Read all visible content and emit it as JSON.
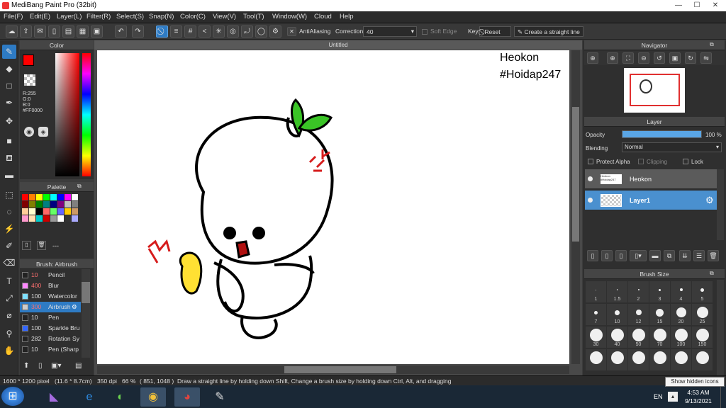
{
  "window": {
    "title": "MediBang Paint Pro (32bit)",
    "min": "—",
    "max": "☐",
    "close": "✕"
  },
  "menu": [
    "File(F)",
    "Edit(E)",
    "Layer(L)",
    "Filter(R)",
    "Select(S)",
    "Snap(N)",
    "Color(C)",
    "View(V)",
    "Tool(T)",
    "Window(W)",
    "Cloud",
    "Help"
  ],
  "toolbar": {
    "antialiasing": "AntiAliasing",
    "correction_label": "Correction",
    "correction_value": "40",
    "soft_edge": "Soft Edge",
    "key": "Key",
    "reset": "Reset",
    "straight_line": "Create a straight line"
  },
  "color_panel": {
    "title": "Color",
    "r": "R:255",
    "g": "G:0",
    "b": "B:0",
    "hex": "#FF0000",
    "accent": "#ff0000"
  },
  "palette_panel": {
    "title": "Palette",
    "footer": "---"
  },
  "brush_panel": {
    "title": "Brush: Airbrush",
    "brushes": [
      {
        "size": "10",
        "name": "Pencil",
        "color": "#222222"
      },
      {
        "size": "400",
        "name": "Blur",
        "color": "#ff88ff"
      },
      {
        "size": "100",
        "name": "Watercolor",
        "color": "#7fe0ff"
      },
      {
        "size": "300",
        "name": "Airbrush",
        "color": "#cccccc"
      },
      {
        "size": "10",
        "name": "Pen",
        "color": "#222222"
      },
      {
        "size": "100",
        "name": "Sparkle Bru",
        "color": "#3366ff"
      },
      {
        "size": "282",
        "name": "Rotation Sy",
        "color": "#222222"
      },
      {
        "size": "10",
        "name": "Pen (Sharp",
        "color": "#222222"
      }
    ]
  },
  "canvas": {
    "tab": "Untitled",
    "text_line1": "Heokon",
    "text_line2": "#Hoidap247"
  },
  "navigator": {
    "title": "Navigator"
  },
  "layer_panel": {
    "title": "Layer",
    "opacity_label": "Opacity",
    "opacity_value": "100 %",
    "opacity_fraction": 1.0,
    "blending_label": "Blending",
    "blending_value": "Normal",
    "protect_alpha": "Protect Alpha",
    "clipping": "Clipping",
    "lock": "Lock",
    "layers": [
      {
        "name": "Heokon",
        "thumb": "Heokon #Hoidap247",
        "selected": false
      },
      {
        "name": "Layer1",
        "selected": true
      }
    ]
  },
  "brush_size_panel": {
    "title": "Brush Size",
    "sizes": [
      "1",
      "1.5",
      "2",
      "3",
      "4",
      "5",
      "7",
      "10",
      "12",
      "15",
      "20",
      "25",
      "30",
      "40",
      "50",
      "70",
      "100",
      "150",
      "",
      "",
      "",
      "",
      "",
      ""
    ],
    "tooltip": "Show hidden icons"
  },
  "status": {
    "size": "1600 * 1200 pixel",
    "cm": "(11.6 * 8.7cm)",
    "dpi": "350 dpi",
    "zoom": "66 %",
    "coords": "( 851, 1048 )",
    "hint": "Draw a straight line by holding down Shift, Change a brush size by holding down Ctrl, Alt, and dragging"
  },
  "taskbar": {
    "lang": "EN",
    "time": "4:53 AM",
    "date": "9/13/2021"
  }
}
